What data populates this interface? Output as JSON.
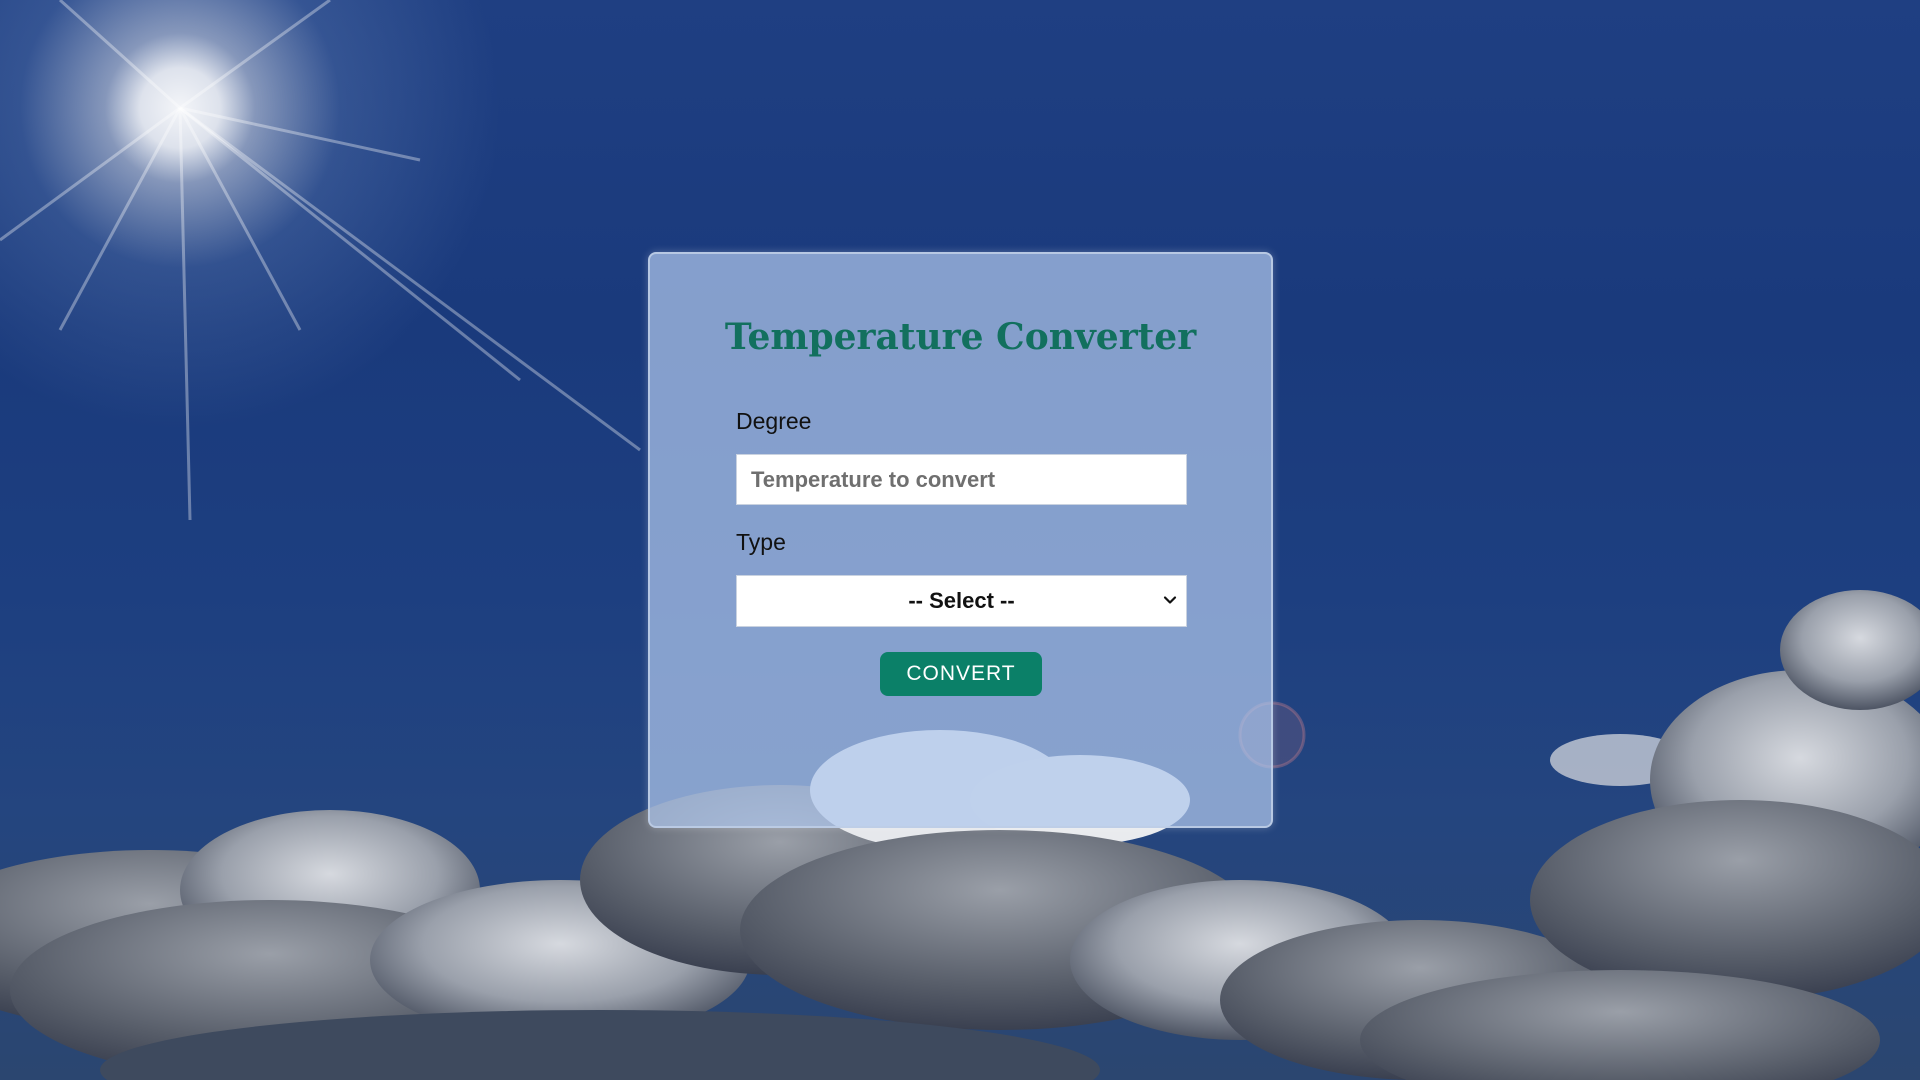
{
  "form": {
    "title": "Temperature Converter",
    "degree_label": "Degree",
    "degree_placeholder": "Temperature to convert",
    "degree_value": "",
    "type_label": "Type",
    "type_selected": "-- Select --",
    "convert_label": "CONVERT"
  },
  "colors": {
    "title": "#12705e",
    "button_bg": "#0b8068",
    "button_text": "#ffffff"
  },
  "icons": {
    "select_chevron": "chevron-down-icon"
  }
}
